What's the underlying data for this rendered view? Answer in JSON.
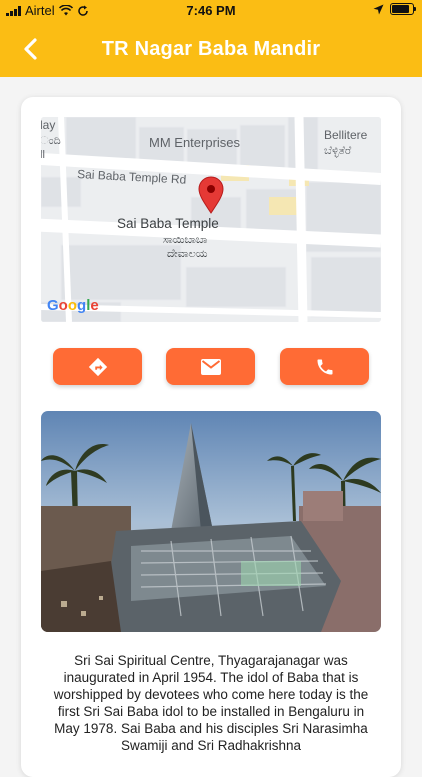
{
  "status": {
    "carrier": "Airtel",
    "time": "7:46 PM"
  },
  "header": {
    "title": "TR Nagar Baba Mandir",
    "back_icon": "chevron-left-icon"
  },
  "map": {
    "labels": {
      "top_left_1": "lay",
      "top_left_2": "ಂದಿ",
      "top_left_3": "ll",
      "enterprises": "MM Enterprises",
      "bellitere": "Bellitere",
      "bellitere_kn": "ಬೆಳ್ಳಿತೆರೆ",
      "road": "Sai Baba Temple Rd",
      "temple": "Sai Baba Temple",
      "temple_kn_1": "ಸಾಯಿಬಾಬಾ",
      "temple_kn_2": "ದೇವಾಲಯ"
    },
    "logo": "Google",
    "pin_color": "#e53935"
  },
  "actions": {
    "directions_icon": "directions-icon",
    "email_icon": "mail-icon",
    "call_icon": "phone-icon",
    "color": "#ff6b35"
  },
  "description": "Sri Sai Spiritual Centre, Thyagarajanagar was inaugurated in April 1954. The idol of Baba that is worshipped by devotees who come here today is the first Sri Sai Baba idol to be installed in Bengaluru in May 1978. Sai Baba and his disciples Sri Narasimha Swamiji and Sri Radhakrishna"
}
